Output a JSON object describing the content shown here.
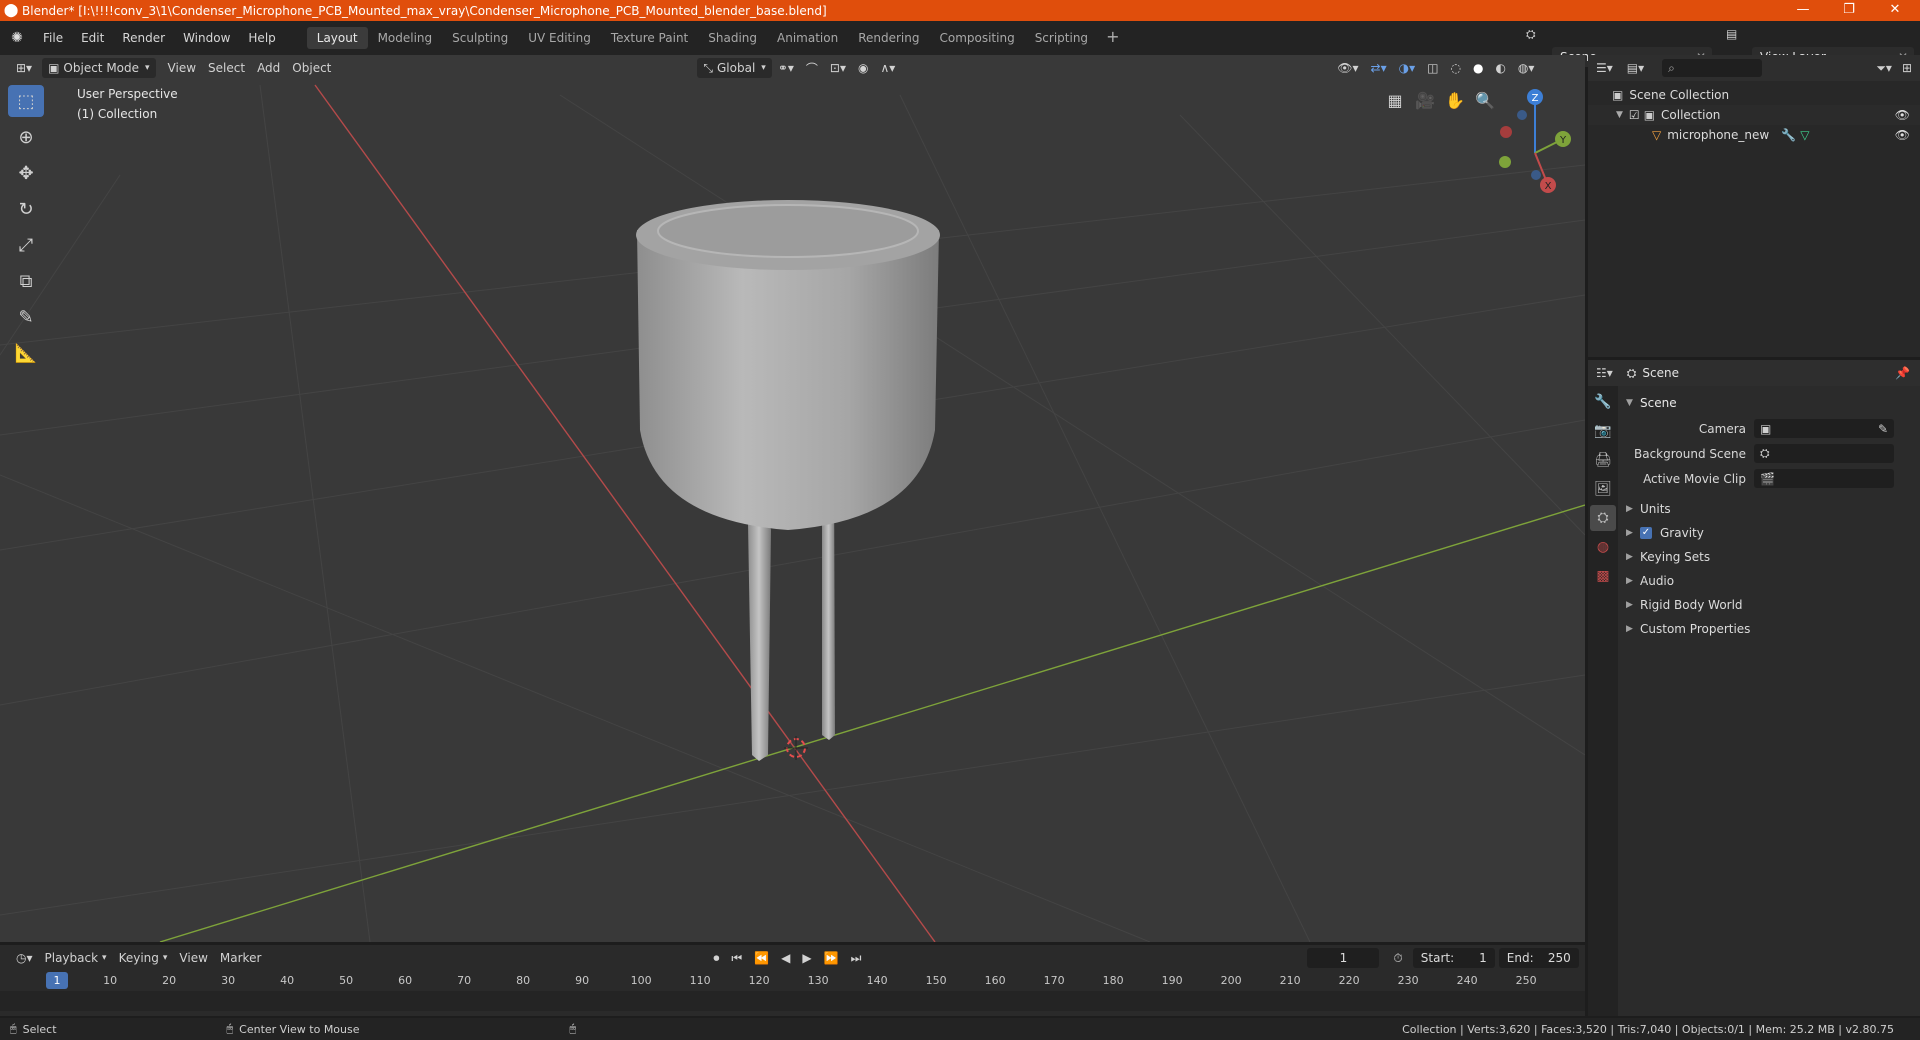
{
  "window": {
    "title": "Blender* [I:\\!!!!conv_3\\1\\Condenser_Microphone_PCB_Mounted_max_vray\\Condenser_Microphone_PCB_Mounted_blender_base.blend]",
    "minimize": "—",
    "restore": "❐",
    "close": "✕"
  },
  "menu": [
    "File",
    "Edit",
    "Render",
    "Window",
    "Help"
  ],
  "workspaces": [
    "Layout",
    "Modeling",
    "Sculpting",
    "UV Editing",
    "Texture Paint",
    "Shading",
    "Animation",
    "Rendering",
    "Compositing",
    "Scripting"
  ],
  "active_workspace": "Layout",
  "scene_selector": "Scene",
  "view_layer_selector": "View Layer",
  "viewport": {
    "mode": "Object Mode",
    "menus": [
      "View",
      "Select",
      "Add",
      "Object"
    ],
    "transform_orientation": "Global",
    "info_line1": "User Perspective",
    "info_line2": "(1) Collection",
    "gizmo_axes": {
      "z": "Z",
      "y": "Y",
      "x": "X"
    }
  },
  "outliner": {
    "rows": [
      {
        "label": "Scene Collection"
      },
      {
        "label": "Collection"
      },
      {
        "label": "microphone_new"
      }
    ]
  },
  "properties": {
    "header": "Scene",
    "panel_title": "Scene",
    "fields": [
      {
        "label": "Camera"
      },
      {
        "label": "Background Scene"
      },
      {
        "label": "Active Movie Clip"
      }
    ],
    "subpanels": [
      "Units",
      "Gravity",
      "Keying Sets",
      "Audio",
      "Rigid Body World",
      "Custom Properties"
    ],
    "gravity_checked": true
  },
  "timeline": {
    "menus": [
      "Playback",
      "Keying",
      "View",
      "Marker"
    ],
    "current_frame": "1",
    "start_label": "Start:",
    "start_value": "1",
    "end_label": "End:",
    "end_value": "250",
    "ruler": [
      "1",
      "10",
      "20",
      "30",
      "40",
      "50",
      "60",
      "70",
      "80",
      "90",
      "100",
      "110",
      "120",
      "130",
      "140",
      "150",
      "160",
      "170",
      "180",
      "190",
      "200",
      "210",
      "220",
      "230",
      "240",
      "250"
    ]
  },
  "statusbar": {
    "left_action": "Select",
    "middle_action": "Center View to Mouse",
    "stats": "Collection | Verts:3,620 | Faces:3,520 | Tris:7,040 | Objects:0/1 | Mem: 25.2 MB | v2.80.75"
  },
  "colors": {
    "title_bar": "#e04e0c",
    "accent": "#4772b3",
    "x_axis": "#c24b4b",
    "y_axis": "#7ea33a"
  }
}
